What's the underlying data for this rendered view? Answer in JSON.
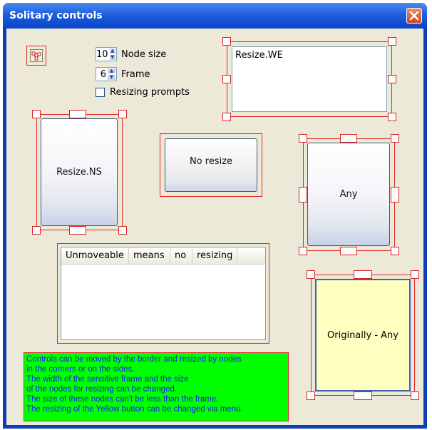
{
  "window": {
    "title": "Solitary controls"
  },
  "settings": {
    "node_size": {
      "value": "10",
      "label": "Node size"
    },
    "frame": {
      "value": "6",
      "label": "Frame"
    },
    "resizing_prompts": {
      "label": "Resizing prompts",
      "checked": false
    }
  },
  "controls": {
    "resize_we": "Resize.WE",
    "resize_ns": "Resize.NS",
    "no_resize": "No resize",
    "any": "Any",
    "originally_any": "Originally - Any"
  },
  "listview": {
    "columns": [
      "Unmoveable",
      "means",
      "no",
      "resizing"
    ]
  },
  "info_lines": [
    "Controls can be moved by the border and resized by nodes",
    "in the corners or on the sides.",
    "The width of the sensitive frame and the size",
    "of the nodes for resizing can be changed.",
    "The size of these nodes can't be less than the frame.",
    "The resizing of the Yellow button can be changed via menu."
  ],
  "colors": {
    "frame": "#e02828",
    "info_background": "#00ff00",
    "info_text": "#1a1aee",
    "yellow_button": "#ffffc0"
  }
}
